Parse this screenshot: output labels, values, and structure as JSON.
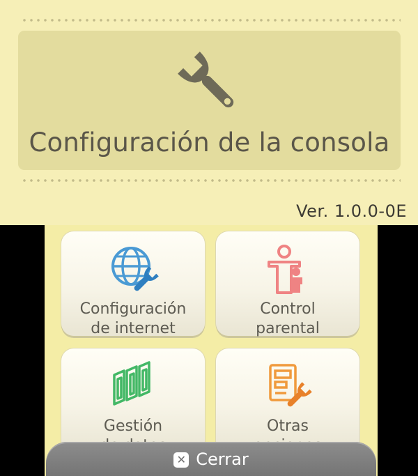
{
  "top_screen": {
    "title": "Configuración de la consola",
    "icon": "wrench-icon",
    "version": "Ver. 1.0.0-0E"
  },
  "menu": {
    "items": [
      {
        "line1": "Configuración",
        "line2": "de internet",
        "icon": "globe-wrench-icon",
        "color": "#4a9ad4"
      },
      {
        "line1": "Control",
        "line2": "parental",
        "icon": "parental-figures-icon",
        "color": "#ef8383"
      },
      {
        "line1": "Gestión",
        "line2": "de datos",
        "icon": "data-cards-icon",
        "color": "#43b866"
      },
      {
        "line1": "Otras",
        "line2": "opciones",
        "icon": "options-wrench-icon",
        "color": "#f09a3c"
      }
    ]
  },
  "close_button": {
    "label": "Cerrar",
    "icon": "x-button-icon",
    "badge": "✕"
  },
  "colors": {
    "top_background": "#f6efb7",
    "title_panel": "#e3dc9e",
    "bottom_background": "#f4eda6",
    "text": "#5a5649"
  }
}
